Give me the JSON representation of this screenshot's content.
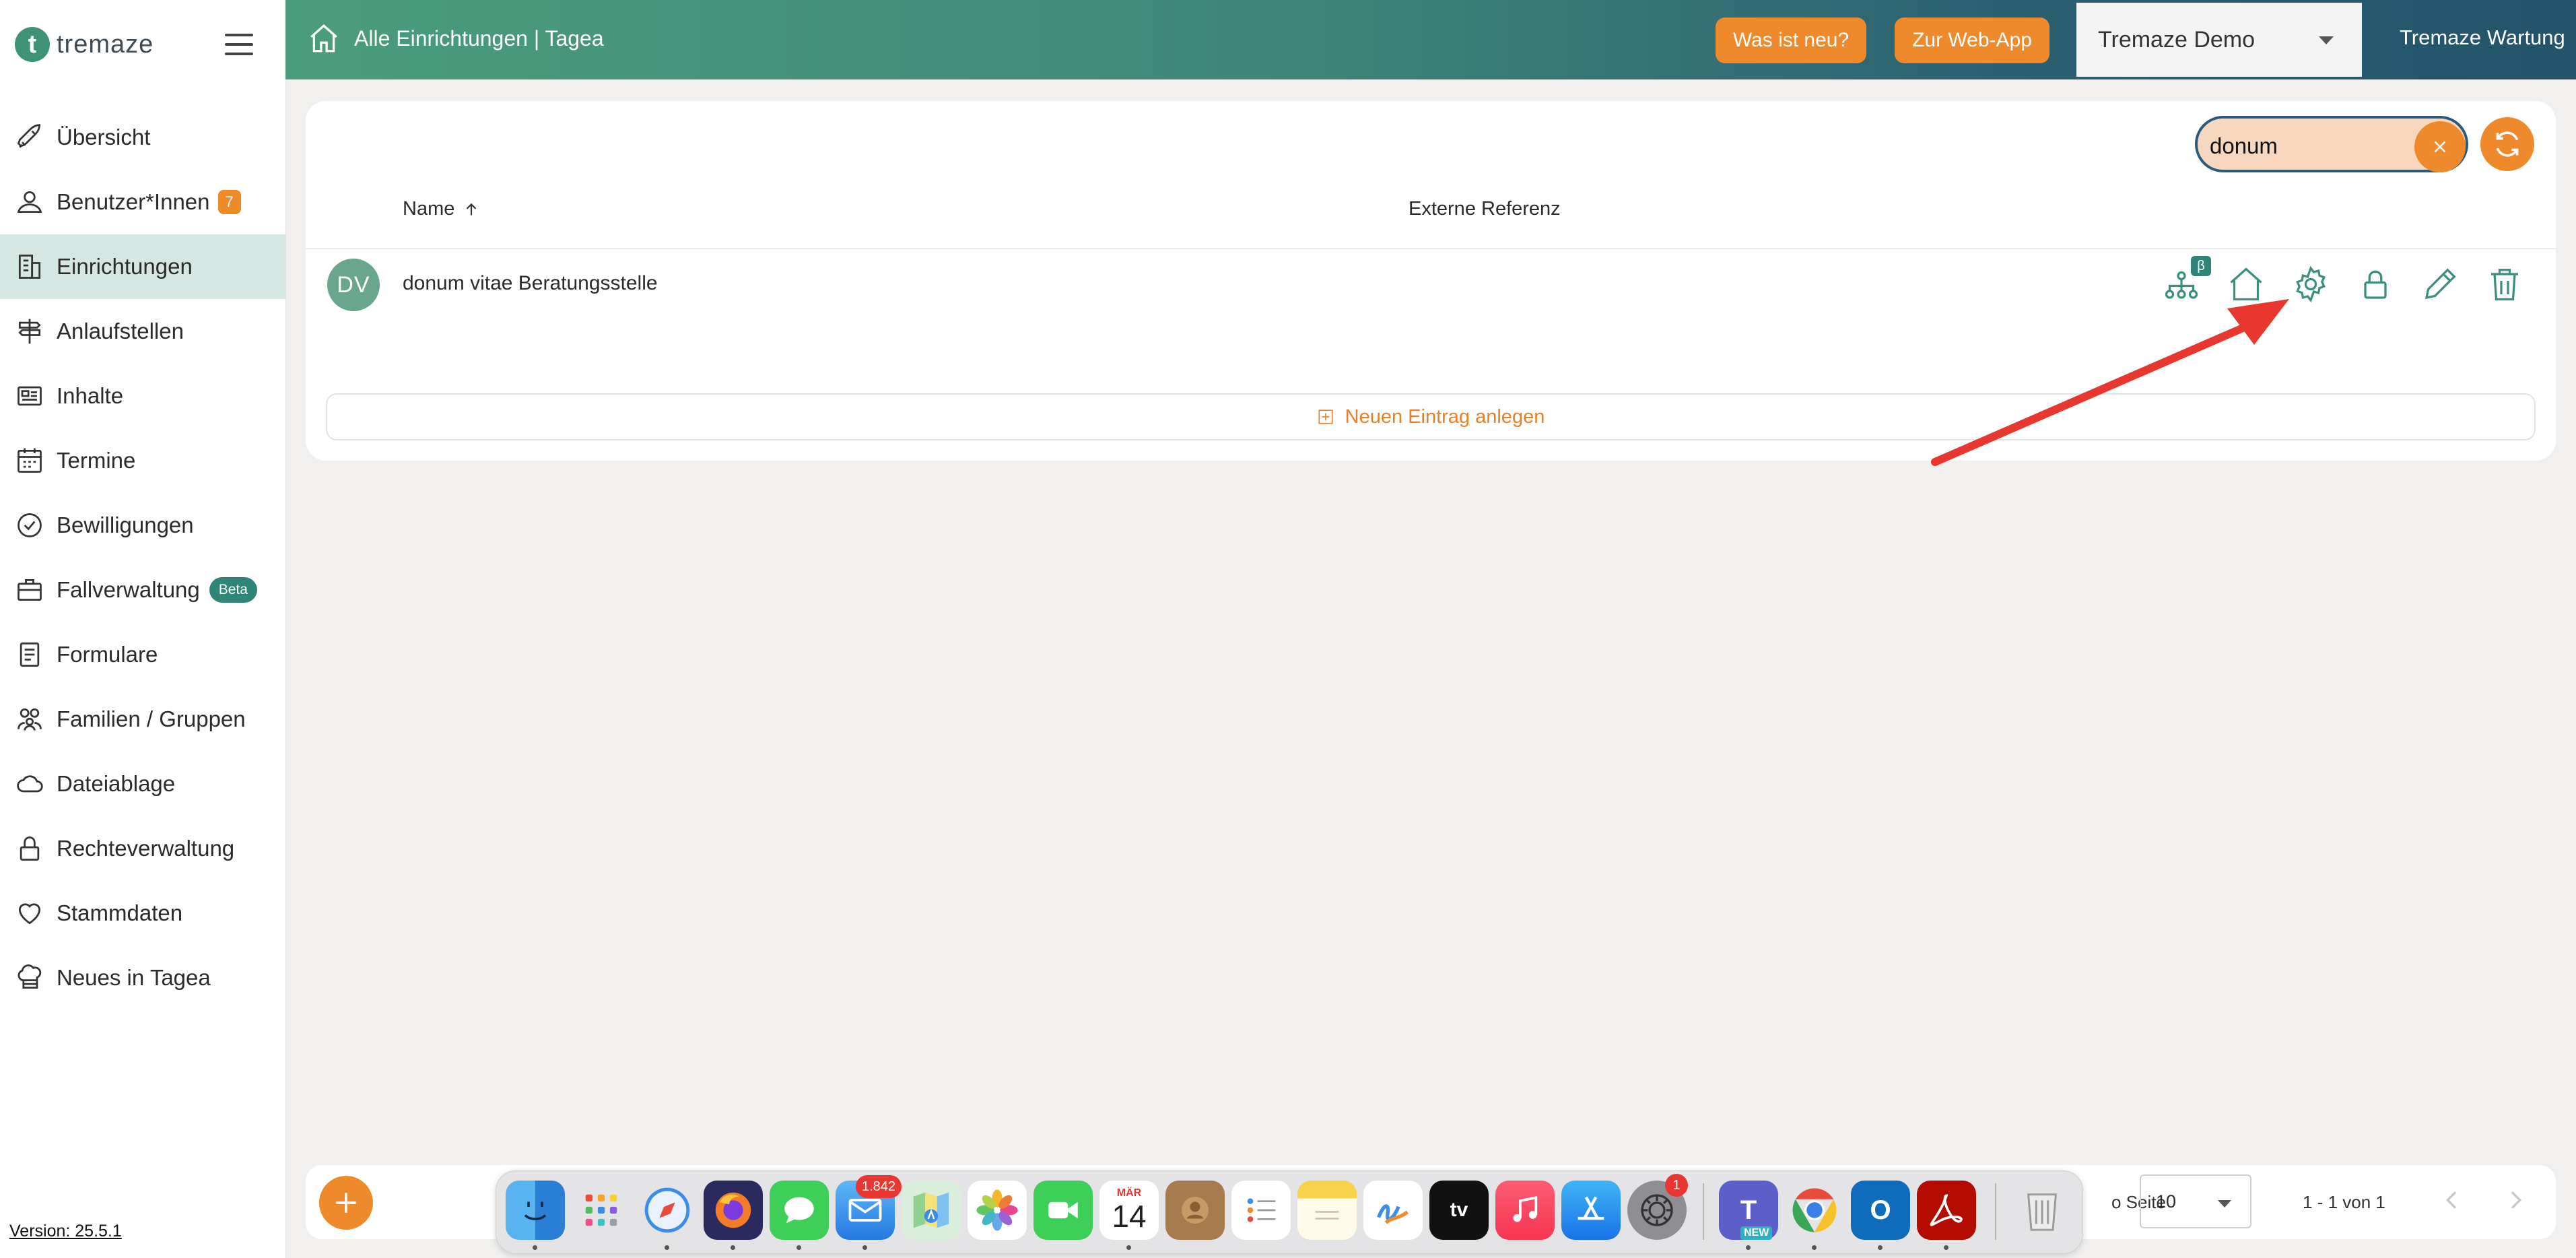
{
  "app": {
    "logo_text": "tremaze",
    "logo_letter": "t",
    "version": "Version: 25.5.1"
  },
  "sidebar": {
    "items": [
      {
        "label": "Übersicht",
        "icon": "rocket-icon"
      },
      {
        "label": "Benutzer*Innen",
        "icon": "user-icon",
        "badge": "7"
      },
      {
        "label": "Einrichtungen",
        "icon": "building-icon",
        "active": true
      },
      {
        "label": "Anlaufstellen",
        "icon": "signpost-icon"
      },
      {
        "label": "Inhalte",
        "icon": "newspaper-icon"
      },
      {
        "label": "Termine",
        "icon": "calendar-icon"
      },
      {
        "label": "Bewilligungen",
        "icon": "check-circle-icon"
      },
      {
        "label": "Fallverwaltung",
        "icon": "briefcase-icon",
        "badge": "Beta"
      },
      {
        "label": "Formulare",
        "icon": "form-icon"
      },
      {
        "label": "Familien / Gruppen",
        "icon": "group-icon"
      },
      {
        "label": "Dateiablage",
        "icon": "cloud-icon"
      },
      {
        "label": "Rechteverwaltung",
        "icon": "lock-icon"
      },
      {
        "label": "Stammdaten",
        "icon": "heart-icon"
      },
      {
        "label": "Neues in Tagea",
        "icon": "chef-hat-icon"
      }
    ]
  },
  "header": {
    "breadcrumb": "Alle Einrichtungen | Tagea",
    "whats_new": "Was ist neu?",
    "web_app": "Zur Web-App",
    "tenant": "Tremaze Demo",
    "maintenance": "Tremaze Wartung"
  },
  "search": {
    "value": "donum"
  },
  "table": {
    "columns": [
      "Name",
      "Externe Referenz"
    ],
    "rows": [
      {
        "initials": "DV",
        "name": "donum vitae Beratungsstelle",
        "external_ref": ""
      }
    ],
    "row_actions": [
      "org-chart-icon",
      "home-icon",
      "settings-icon",
      "lock-icon",
      "edit-icon",
      "trash-icon"
    ],
    "beta_tag": "β",
    "new_entry": "Neuen Eintrag anlegen"
  },
  "pagination": {
    "per_page_label": "o Seite",
    "per_page_value": "10",
    "range": "1 - 1 von 1"
  },
  "dock": {
    "apps": [
      "Finder",
      "Launchpad",
      "Safari",
      "Firefox",
      "Messages",
      "Mail",
      "Maps",
      "Photos",
      "FaceTime",
      "Calendar",
      "Contacts",
      "Reminders",
      "Notes",
      "Freeform",
      "TV",
      "Music",
      "App Store",
      "System Settings",
      "Teams",
      "Chrome",
      "Outlook",
      "Acrobat",
      "Trash"
    ],
    "mail_badge": "1.842",
    "settings_badge": "1",
    "calendar_month": "MÄR",
    "calendar_day": "14",
    "tv_label": "tv",
    "teams_tag": "NEW"
  },
  "colors": {
    "accent": "#ef8a2c",
    "brand_green": "#3e9375",
    "teal": "#2f8678",
    "active_row": "#d5e7e2",
    "arrow": "#e8372f"
  }
}
